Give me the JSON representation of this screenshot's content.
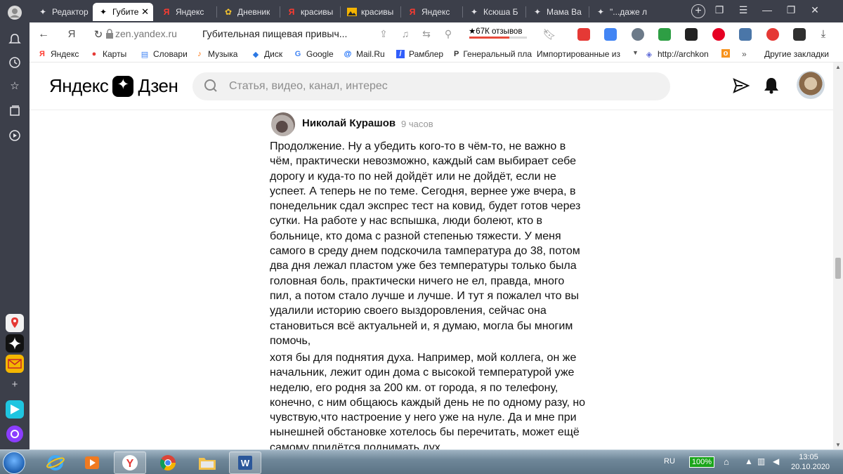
{
  "browser": {
    "tabs": [
      {
        "title": "Редактор",
        "icon": "dzen-star-icon"
      },
      {
        "title": "Губите",
        "icon": "dzen-star-icon",
        "active": true
      },
      {
        "title": "Яндекс",
        "icon": "yandex-icon"
      },
      {
        "title": "Дневник",
        "icon": "diary-icon"
      },
      {
        "title": "красивы",
        "icon": "yandex-icon"
      },
      {
        "title": "красивы",
        "icon": "images-icon"
      },
      {
        "title": "Яндекс",
        "icon": "yandex-icon"
      },
      {
        "title": "Ксюша Б",
        "icon": "dzen-star-icon"
      },
      {
        "title": "Мама Ва",
        "icon": "dzen-star-icon"
      },
      {
        "title": "\"...даже л",
        "icon": "dzen-star-icon"
      }
    ],
    "url": "zen.yandex.ru",
    "page_title": "Губительная пищевая привыч...",
    "reviews": "★67К отзывов",
    "review_rating_fraction": 0.7
  },
  "bookmarks": [
    {
      "label": "Яндекс",
      "icon": "yandex-icon"
    },
    {
      "label": "Карты",
      "icon": "maps-pin-icon"
    },
    {
      "label": "Словари",
      "icon": "dictionary-icon"
    },
    {
      "label": "Музыка",
      "icon": "music-icon"
    },
    {
      "label": "Диск",
      "icon": "disk-icon"
    },
    {
      "label": "Google",
      "icon": "google-icon"
    },
    {
      "label": "Mail.Ru",
      "icon": "mailru-icon"
    },
    {
      "label": "Рамблер",
      "icon": "rambler-icon"
    },
    {
      "label": "Генеральный план",
      "icon": "bookmark-page-icon"
    },
    {
      "label": "Импортированные из",
      "icon": "folder-icon"
    },
    {
      "label": "http://archkon",
      "icon": "globe-icon"
    },
    {
      "label": "Другие закладки",
      "icon": "folder-icon"
    }
  ],
  "dzen": {
    "logo_left": "Яндекс",
    "logo_right": "Дзен",
    "search_placeholder": "Статья, видео, канал, интерес"
  },
  "comment": {
    "author": "Николай Курашов",
    "time": "9 часов",
    "paragraph1": "Продолжение. Ну а убедить кого-то в чём-то, не важно в чём, практически невозможно, каждый сам выбирает себе дорогу и куда-то по ней дойдёт или не дойдёт, если не успеет. А теперь не по теме. Сегодня, вернее уже вчера, в понедельник сдал экспрес тест на ковид, будет готов через сутки. На работе у нас вспышка, люди болеют, кто в больнице, кто дома с разной степенью тяжести. У меня самого в среду днем подскочила тампература до 38, потом два дня лежал пластом уже без температуры только была головная боль, практически ничего не ел, правда, много пил, а потом стало лучше и лучше. И тут я пожалел что вы удалили историю своего выздоровления, сейчас она становиться всё актуальней и, я думаю, могла бы многим помочь,",
    "paragraph2": "хотя бы для поднятия духа. Например, мой коллега, он же начальник, лежит один дома с высокой температурой уже неделю, его родня за 200 км. от города, я по телефону, конечно, с ним общаюсь каждый день не по одному разу, но чувствую,что настроение у него уже на нуле. Да и мне при нынешней обстановке хотелось бы перечитать, может ещё самому придётся поднимать дух."
  },
  "taskbar": {
    "language": "RU",
    "battery": "100%",
    "time": "13:05",
    "date": "20.10.2020"
  },
  "colors": {
    "browser_chrome": "#3c3f4a",
    "review_bar": "#e84b3c",
    "battery": "#1aa51a"
  }
}
